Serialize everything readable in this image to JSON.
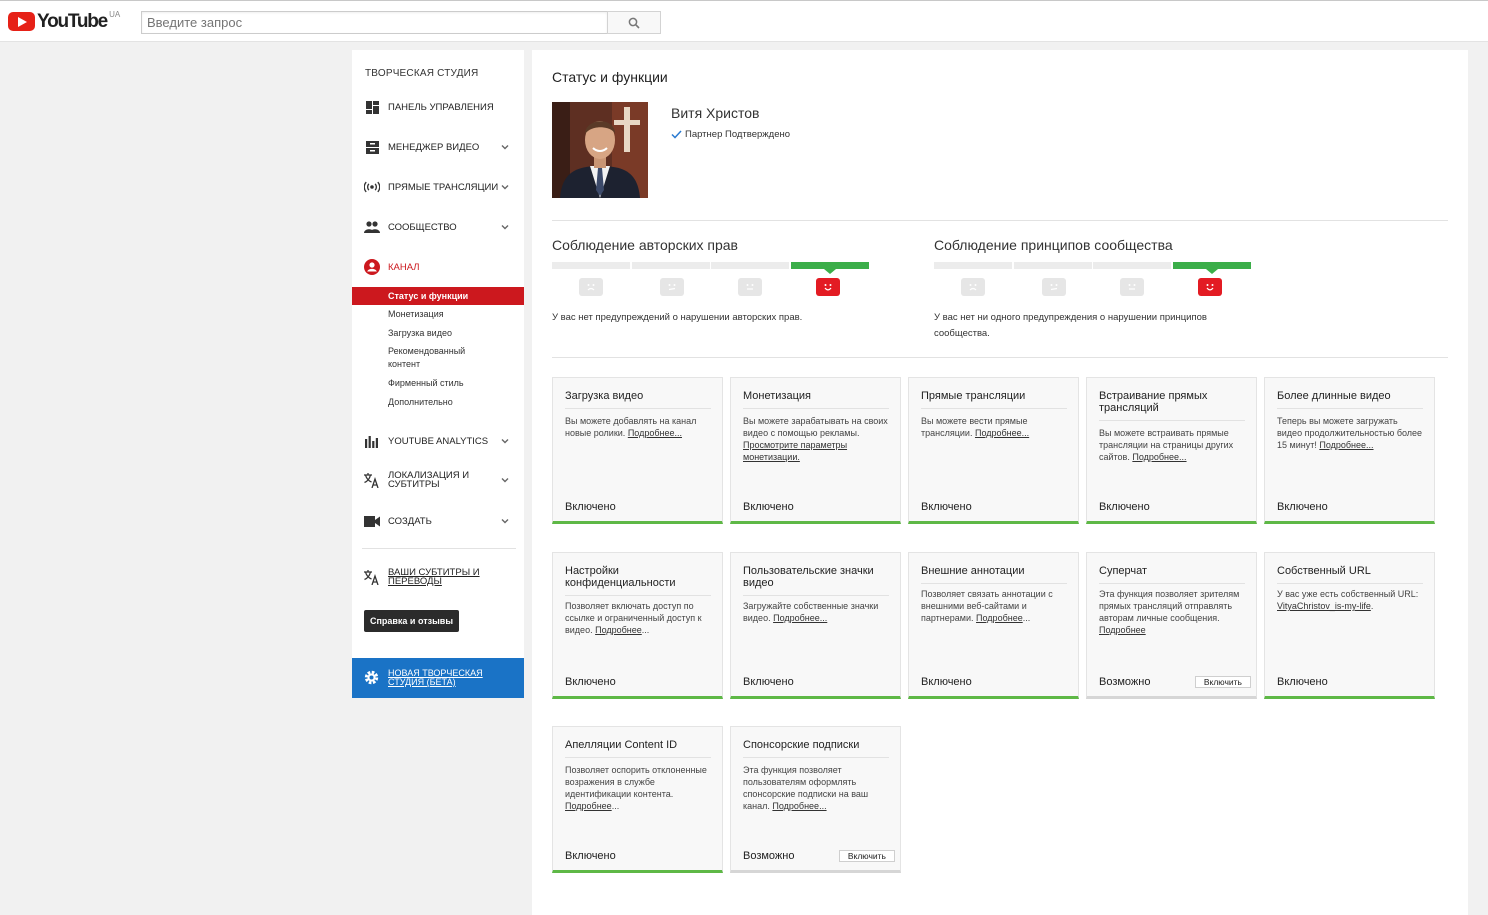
{
  "header": {
    "logo_text": "YouTube",
    "region": "UA",
    "search_placeholder": "Введите запрос"
  },
  "sidebar": {
    "title": "ТВОРЧЕСКАЯ СТУДИЯ",
    "items": [
      {
        "label": "ПАНЕЛЬ УПРАВЛЕНИЯ",
        "icon": "dashboard-icon"
      },
      {
        "label": "МЕНЕДЖЕР ВИДЕО",
        "icon": "video-manager-icon"
      },
      {
        "label": "ПРЯМЫЕ ТРАНСЛЯЦИИ",
        "icon": "live-icon"
      },
      {
        "label": "СООБЩЕСТВО",
        "icon": "community-icon"
      },
      {
        "label": "КАНАЛ",
        "icon": "channel-icon"
      },
      {
        "label": "YOUTUBE ANALYTICS",
        "icon": "analytics-icon"
      },
      {
        "label": "ЛОКАЛИЗАЦИЯ И СУБТИТРЫ",
        "icon": "translate-icon"
      },
      {
        "label": "СОЗДАТЬ",
        "icon": "camera-icon"
      },
      {
        "label": "ВАШИ СУБТИТРЫ И ПЕРЕВОДЫ",
        "icon": "subtitles-icon"
      }
    ],
    "channel_sub": [
      "Статус и функции",
      "Монетизация",
      "Загрузка видео",
      "Рекомендованный контент",
      "Фирменный стиль",
      "Дополнительно"
    ],
    "help_button": "Справка и отзывы",
    "beta_label": "НОВАЯ ТВОРЧЕСКАЯ СТУДИЯ (БЕТА)",
    "accent_color": "#cc181e",
    "beta_color": "#1a73c6"
  },
  "main": {
    "title": "Статус и функции",
    "user": {
      "name": "Витя Христов",
      "partner": "Партнер Подтверждено"
    },
    "copyright": {
      "title": "Соблюдение авторских прав",
      "desc": "У вас нет предупреждений о нарушении авторских прав."
    },
    "community": {
      "title": "Соблюдение принципов сообщества",
      "desc": "У вас нет ни одного предупреждения о нарушении принципов сообщества."
    },
    "cards": [
      {
        "title": "Загрузка видео",
        "desc": "Вы можете добавлять на канал новые ролики.",
        "link": "Подробнее...",
        "status": "Включено"
      },
      {
        "title": "Монетизация",
        "desc": "Вы можете зарабатывать на своих видео с помощью рекламы.",
        "link": "Просмотрите параметры монетизации.",
        "status": "Включено"
      },
      {
        "title": "Прямые трансляции",
        "desc": "Вы можете вести прямые трансляции.",
        "link": "Подробнее...",
        "status": "Включено"
      },
      {
        "title": "Встраивание прямых трансляций",
        "desc": "Вы можете встраивать прямые трансляции на страницы других сайтов.",
        "link": "Подробнее...",
        "status": "Включено"
      },
      {
        "title": "Более длинные видео",
        "desc": "Теперь вы можете загружать видео продолжительностью более 15 минут!",
        "link": "Подробнее...",
        "status": "Включено"
      },
      {
        "title": "Настройки конфиденциальности",
        "desc": "Позволяет включать доступ по ссылке и ограниченный доступ к видео.",
        "link": "Подробнее",
        "tail": "...",
        "status": "Включено"
      },
      {
        "title": "Пользовательские значки видео",
        "desc": "Загружайте собственные значки видео.",
        "link": "Подробнее...",
        "status": "Включено"
      },
      {
        "title": "Внешние аннотации",
        "desc": "Позволяет связать аннотации с внешними веб-сайтами и партнерами.",
        "link": "Подробнее",
        "tail": "...",
        "status": "Включено"
      },
      {
        "title": "Суперчат",
        "desc": "Эта функция позволяет зрителям прямых трансляций отправлять авторам личные сообщения.",
        "link": "Подробнее",
        "status": "Возможно",
        "button": "Включить"
      },
      {
        "title": "Собственный URL",
        "desc": "У вас уже есть собственный URL:",
        "link": "VityaChristov_is-my-life",
        "tail": ".",
        "status": "Включено"
      },
      {
        "title": "Апелляции Content ID",
        "desc": "Позволяет оспорить отклоненные возражения в службе идентификации контента.",
        "link": "Подробнее",
        "tail": "...",
        "status": "Включено"
      },
      {
        "title": "Спонсорские подписки",
        "desc": "Эта функция позволяет пользователям оформлять спонсорские подписки на ваш канал.",
        "link": "Подробнее...",
        "status": "Возможно",
        "button": "Включить"
      }
    ],
    "enabled_color": "#5eb846",
    "strike_ok_color": "#3bae49",
    "strike_face_active_color": "#e31b23"
  }
}
